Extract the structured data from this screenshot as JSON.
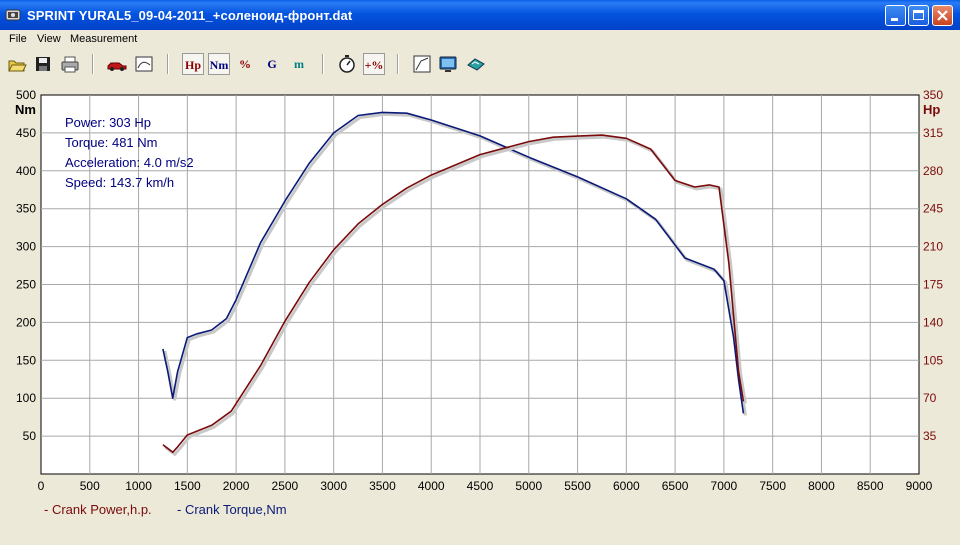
{
  "window": {
    "title": "SPRINT  YURAL5_09-04-2011_+соленоид-фронт.dat",
    "controls": [
      "minimize",
      "maximize",
      "close"
    ]
  },
  "menu": [
    "File",
    "View",
    "Measurement"
  ],
  "toolbar": {
    "buttons": [
      {
        "icon": "open-folder-icon"
      },
      {
        "icon": "save-disk-icon"
      },
      {
        "icon": "print-icon"
      },
      {
        "icon": "car-icon"
      },
      {
        "icon": "graph-window-icon"
      },
      {
        "label": "Hp",
        "color": "#8b0000"
      },
      {
        "label": "Nm",
        "color": "#000080"
      },
      {
        "label": "%",
        "color": "#8b0000"
      },
      {
        "label": "G",
        "color": "#000080"
      },
      {
        "label": "m",
        "color": "#008080"
      },
      {
        "icon": "stopwatch-icon"
      },
      {
        "label": "+%",
        "color": "#8b0000"
      },
      {
        "icon": "curve-chart-icon"
      },
      {
        "icon": "monitor-icon"
      },
      {
        "icon": "export-icon"
      }
    ]
  },
  "info": {
    "power": "Power: 303 Hp",
    "torque": "Torque: 481 Nm",
    "acceleration": "Acceleration: 4.0 m/s2",
    "speed": "Speed: 143.7 km/h"
  },
  "legend": {
    "power": "- Crank Power,h.p.",
    "torque": "- Crank Torque,Nm"
  },
  "chart_data": {
    "type": "line",
    "xlim": [
      0,
      9000
    ],
    "x_ticks": [
      "0",
      "500",
      "1000",
      "1500",
      "2000",
      "2500",
      "3000",
      "3500",
      "4000",
      "4500",
      "5000",
      "5500",
      "6000",
      "6500",
      "7000",
      "7500",
      "8000",
      "8500",
      "9000"
    ],
    "y_left": {
      "unit": "Nm",
      "ylim": [
        0,
        500
      ],
      "ticks": [
        "50",
        "100",
        "150",
        "200",
        "250",
        "300",
        "350",
        "400",
        "450",
        "500"
      ]
    },
    "y_right": {
      "unit": "Hp",
      "ylim": [
        0,
        350
      ],
      "ticks": [
        "35",
        "70",
        "105",
        "140",
        "175",
        "210",
        "245",
        "280",
        "315",
        "350"
      ]
    },
    "grid": true,
    "series": [
      {
        "name": "Crank Torque,Nm",
        "axis": "left",
        "color": "#0a1a78",
        "points": [
          [
            1250,
            165
          ],
          [
            1300,
            135
          ],
          [
            1350,
            100
          ],
          [
            1400,
            135
          ],
          [
            1500,
            180
          ],
          [
            1600,
            185
          ],
          [
            1750,
            190
          ],
          [
            1900,
            205
          ],
          [
            2000,
            230
          ],
          [
            2250,
            305
          ],
          [
            2500,
            360
          ],
          [
            2750,
            410
          ],
          [
            3000,
            450
          ],
          [
            3250,
            473
          ],
          [
            3500,
            477
          ],
          [
            3750,
            476
          ],
          [
            4000,
            467
          ],
          [
            4500,
            446
          ],
          [
            5000,
            418
          ],
          [
            5500,
            392
          ],
          [
            6000,
            363
          ],
          [
            6300,
            336
          ],
          [
            6600,
            285
          ],
          [
            6900,
            270
          ],
          [
            7000,
            255
          ],
          [
            7100,
            180
          ],
          [
            7150,
            125
          ],
          [
            7200,
            80
          ]
        ]
      },
      {
        "name": "Crank Power,h.p.",
        "axis": "right",
        "color": "#7a0a0a",
        "points": [
          [
            1250,
            27
          ],
          [
            1350,
            20
          ],
          [
            1400,
            25
          ],
          [
            1500,
            36
          ],
          [
            1750,
            45
          ],
          [
            1950,
            58
          ],
          [
            2250,
            100
          ],
          [
            2500,
            141
          ],
          [
            2750,
            177
          ],
          [
            3000,
            207
          ],
          [
            3250,
            231
          ],
          [
            3500,
            249
          ],
          [
            3750,
            264
          ],
          [
            4000,
            276
          ],
          [
            4500,
            295
          ],
          [
            5000,
            307
          ],
          [
            5250,
            311
          ],
          [
            5500,
            312
          ],
          [
            5750,
            313
          ],
          [
            6000,
            310
          ],
          [
            6250,
            300
          ],
          [
            6500,
            271
          ],
          [
            6700,
            265
          ],
          [
            6850,
            267
          ],
          [
            6950,
            265
          ],
          [
            7050,
            195
          ],
          [
            7150,
            95
          ],
          [
            7200,
            67
          ]
        ]
      }
    ]
  }
}
